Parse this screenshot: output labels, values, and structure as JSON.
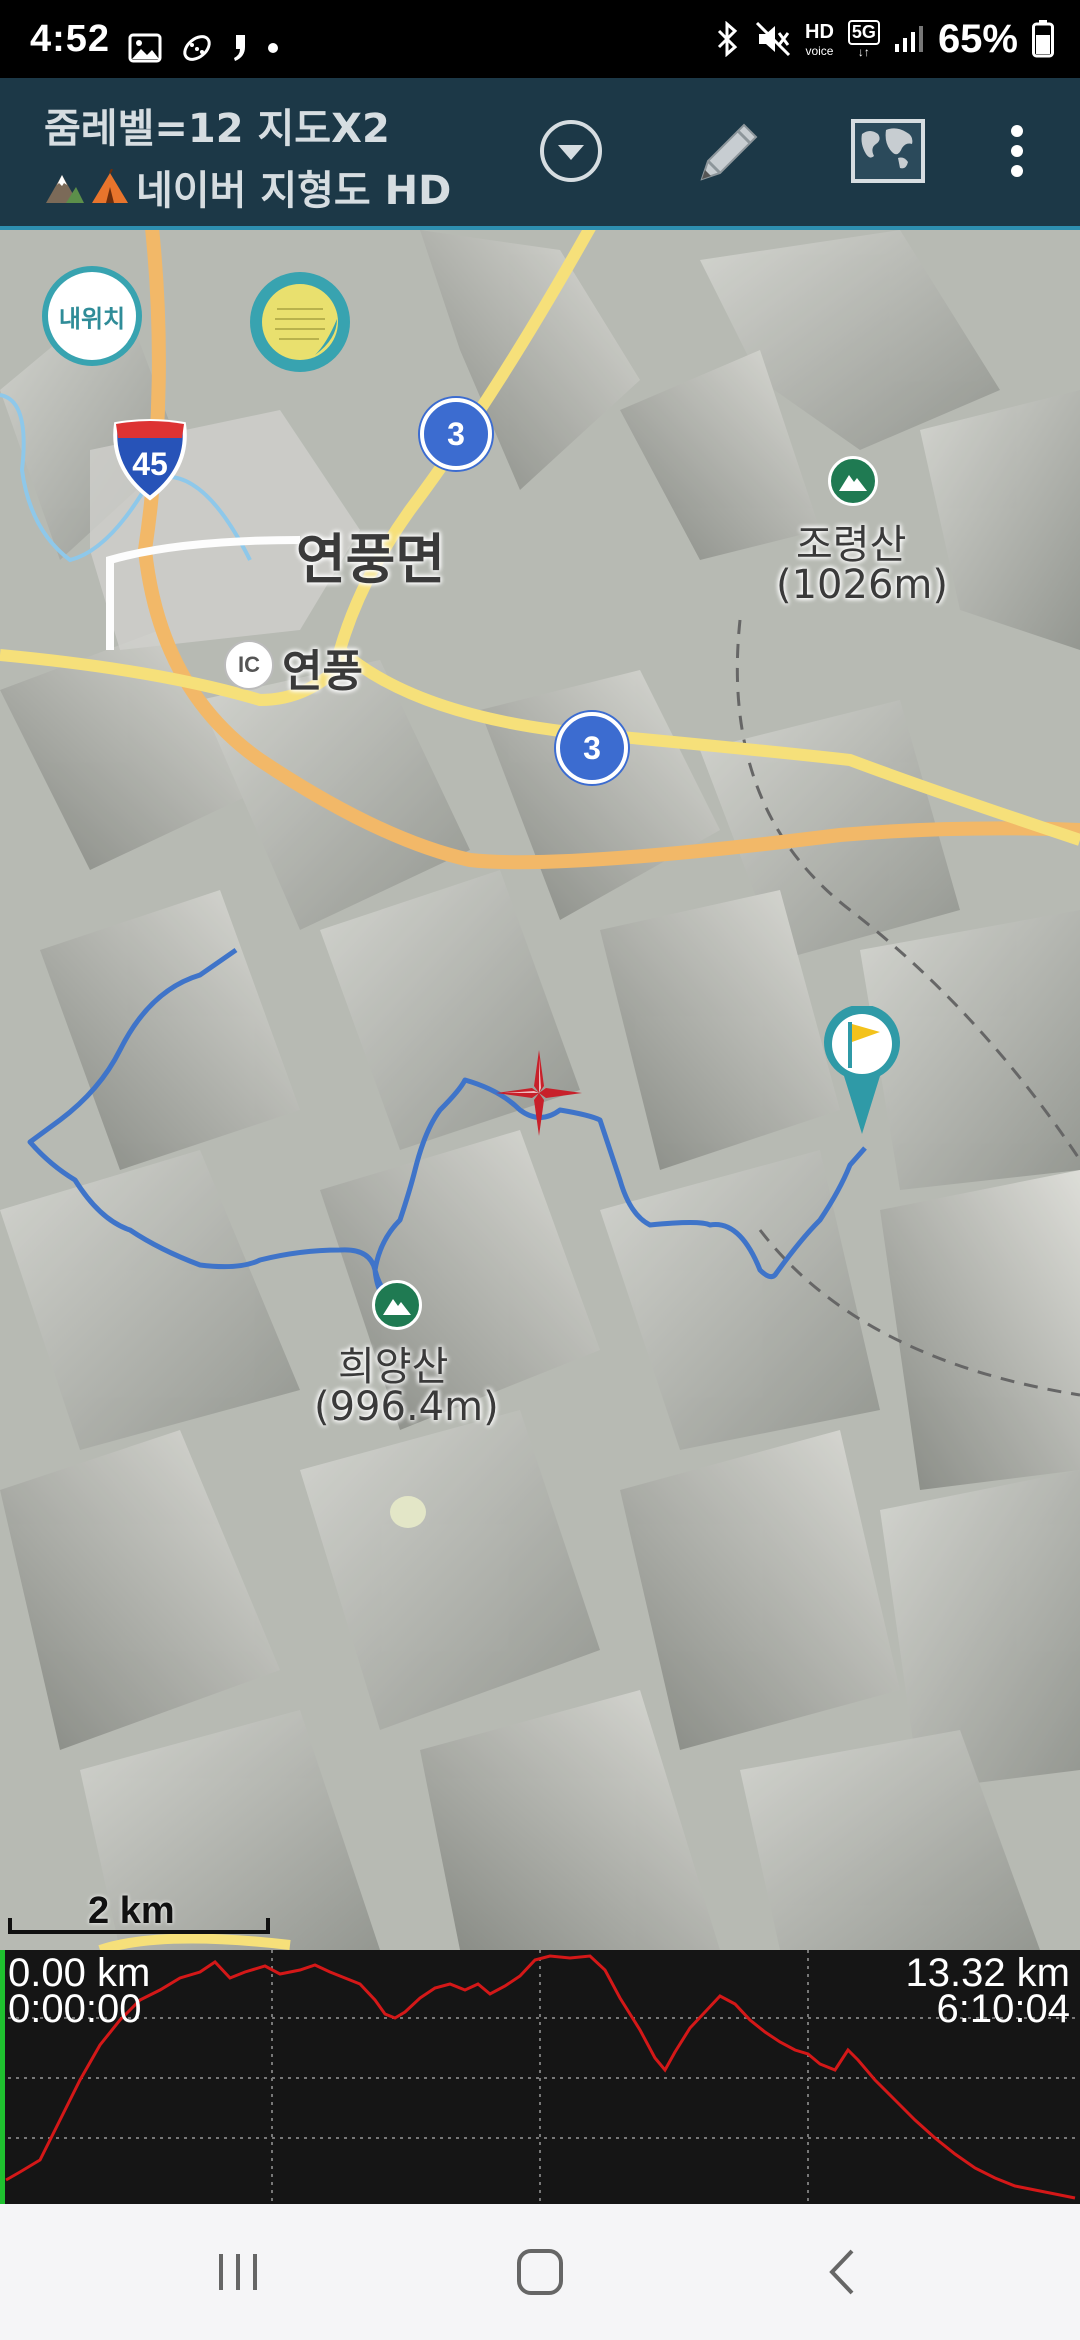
{
  "status_bar": {
    "time": "4:52",
    "battery_percent": "65%",
    "left_icons": [
      "gallery-icon",
      "activity-icon",
      "quote-icon",
      "dot-icon"
    ],
    "right_icons": [
      "bluetooth-icon",
      "mute-icon",
      "hd-voice-icon",
      "5g-icon",
      "signal-icon",
      "battery-icon"
    ],
    "hd_label": "HD",
    "voice_label": "voice",
    "network_label": "5G",
    "battery_level": 0.65
  },
  "app_bar": {
    "title_line1": "줌레벨=12 지도X2",
    "title_line2": "네이버 지형도 HD",
    "title_icons": [
      "mountain-icon",
      "tent-icon"
    ],
    "actions": [
      "dropdown-icon",
      "pencil-icon",
      "map-globe-icon",
      "more-vert-icon"
    ]
  },
  "map": {
    "my_location_label": "내위치",
    "layer_button_icon": "note-icon",
    "labels": {
      "town": "연풍면",
      "ic_badge": "IC",
      "ic_name": "연풍",
      "route_45": "45",
      "route_3a": "3",
      "route_3b": "3",
      "peak1_name": "조령산",
      "peak1_height": "(1026m)",
      "peak2_name": "희양산",
      "peak2_height": "(996.4m)"
    },
    "scale_label": "2 km",
    "icons": [
      "crosshair-icon",
      "flag-marker-icon",
      "mountain-peak-icon"
    ],
    "colors": {
      "track": "#3f74c9",
      "highway": "#f2b868",
      "road": "#f6e07a",
      "marker": "#2f9aa7"
    }
  },
  "elevation_profile": {
    "start_distance": "0.00 km",
    "start_time": "0:00:00",
    "end_distance": "13.32 km",
    "end_time": "6:10:04",
    "line_color": "#d41818"
  },
  "nav_bar": {
    "icons": [
      "recent-apps-icon",
      "home-icon",
      "back-icon"
    ]
  }
}
